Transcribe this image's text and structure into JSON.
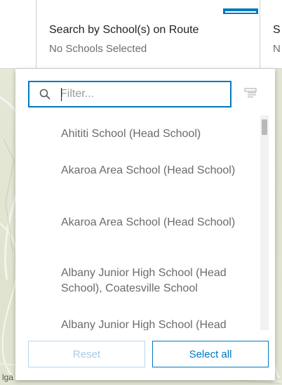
{
  "header": {
    "title": "Search by School(s) on Route",
    "subtitle": "No Schools Selected",
    "next_title_fragment": "S",
    "next_subtitle_fragment": "N",
    "accent_color": "#0079c1"
  },
  "map": {
    "label_fragment": "lga"
  },
  "filter": {
    "value": "",
    "placeholder": "Filter..."
  },
  "list": {
    "items": [
      "Ahititi School (Head School)",
      "Akaroa Area School (Head School)",
      "Akaroa Area School (Head School)",
      "Albany Junior High School (Head School), Coatesville School",
      "Albany Junior High School (Head"
    ]
  },
  "footer": {
    "reset_label": "Reset",
    "select_all_label": "Select all"
  }
}
